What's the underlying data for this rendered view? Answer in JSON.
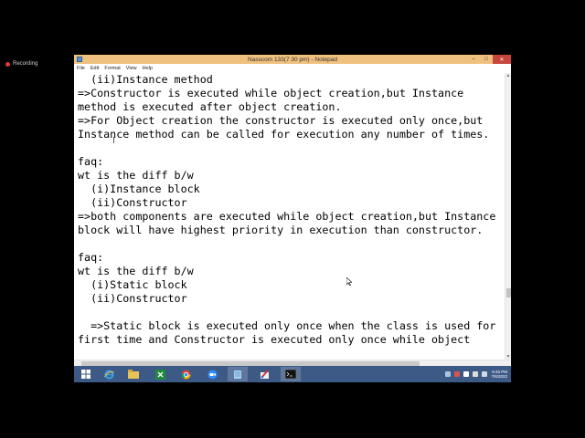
{
  "recording": {
    "label": "Recording",
    "color": "#e03a3a"
  },
  "window": {
    "title": "Nasscom 133(7 30 pm) - Notepad",
    "title_color": "#f0c07e",
    "controls": {
      "minimize": "–",
      "maximize": "□",
      "close": "✕"
    }
  },
  "menu": {
    "file": "File",
    "edit": "Edit",
    "format": "Format",
    "view": "View",
    "help": "Help"
  },
  "editor": {
    "text": "  (ii)Instance method\n=>Constructor is executed while object creation,but Instance\nmethod is executed after object creation.\n=>For Object creation the constructor is executed only once,but\nInstance method can be called for execution any number of times.\n\nfaq:\nwt is the diff b/w\n  (i)Instance block\n  (ii)Constructor\n=>both components are executed while object creation,but Instance\nblock will have highest priority in execution than constructor.\n\nfaq:\nwt is the diff b/w\n  (i)Static block\n  (ii)Constructor\n\n  =>Static block is executed only once when the class is used for\nfirst time and Constructor is executed only once while object"
  },
  "taskbar": {
    "color": "#3d5a86",
    "apps": [
      "windows-start-icon",
      "internet-explorer-icon",
      "file-explorer-icon",
      "excel-icon",
      "chrome-icon",
      "zoom-icon",
      "notepad-icon",
      "paint-icon",
      "command-prompt-icon"
    ],
    "clock": {
      "time": "8:45 PM",
      "date": "7/6/2022"
    }
  }
}
